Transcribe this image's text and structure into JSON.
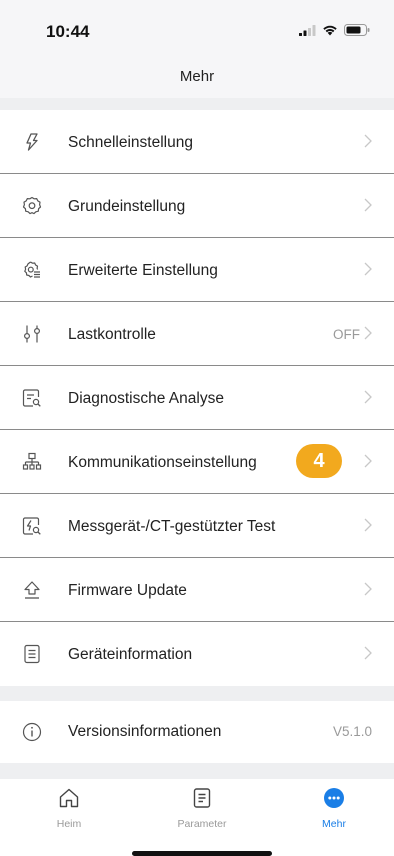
{
  "status_bar": {
    "time": "10:44"
  },
  "header": {
    "title": "Mehr"
  },
  "menu": {
    "items": [
      {
        "label": "Schnelleinstellung",
        "icon": "lightning-icon"
      },
      {
        "label": "Grundeinstellung",
        "icon": "gear-icon"
      },
      {
        "label": "Erweiterte Einstellung",
        "icon": "advanced-settings-icon"
      },
      {
        "label": "Lastkontrolle",
        "icon": "sliders-icon",
        "value": "OFF"
      },
      {
        "label": "Diagnostische Analyse",
        "icon": "diagnosis-icon"
      },
      {
        "label": "Kommunikationseinstellung",
        "icon": "network-icon",
        "badge": "4"
      },
      {
        "label": "Messgerät-/CT-gestützter Test",
        "icon": "meter-test-icon"
      },
      {
        "label": "Firmware Update",
        "icon": "upload-icon"
      },
      {
        "label": "Geräteinformation",
        "icon": "document-icon"
      }
    ]
  },
  "version": {
    "label": "Versionsinformationen",
    "value": "V5.1.0",
    "icon": "info-icon"
  },
  "tab_bar": {
    "tabs": [
      {
        "label": "Heim",
        "icon": "home-icon",
        "active": false
      },
      {
        "label": "Parameter",
        "icon": "parameter-icon",
        "active": false
      },
      {
        "label": "Mehr",
        "icon": "more-icon",
        "active": true
      }
    ]
  },
  "colors": {
    "accent": "#1a7ee6",
    "badge": "#f2a91e",
    "separator": "#eeeff1"
  }
}
